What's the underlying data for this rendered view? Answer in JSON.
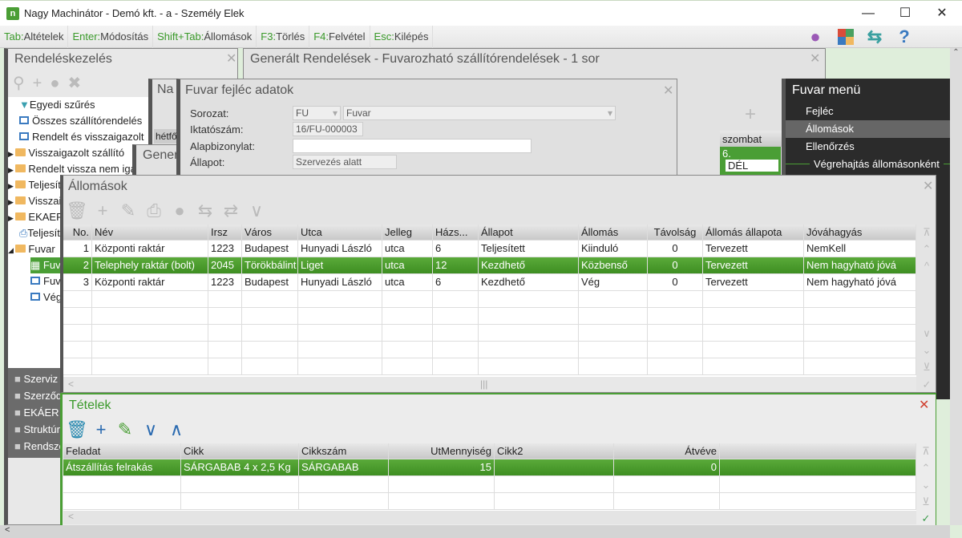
{
  "window": {
    "title": "Nagy Machinátor - Demó kft. - a - Személy Elek",
    "app_icon": "n"
  },
  "shortcuts": [
    {
      "key": "Tab:",
      "label": "Altételek"
    },
    {
      "key": "Enter:",
      "label": "Módosítás"
    },
    {
      "key": "Shift+Tab:",
      "label": "Állomások"
    },
    {
      "key": "F3:",
      "label": "Törlés"
    },
    {
      "key": "F4:",
      "label": "Felvétel"
    },
    {
      "key": "Esc:",
      "label": "Kilépés"
    }
  ],
  "left_panel": {
    "title": "Rendeléskezelés",
    "tree": [
      "Egyedi szűrés",
      "Összes szállítórendelés",
      "Rendelt és visszaigazolt",
      "Visszaigazolt szállító",
      "Rendelt vissza nem igazolt",
      "Teljesített",
      "Visszaigazolt",
      "EKAER",
      "Teljesített",
      "Fuvar",
      "Fuvar",
      "Fuvar",
      "Vég"
    ],
    "nav": [
      "Szerviz",
      "Szerződés",
      "EKÁER",
      "Struktúra",
      "Rendszer"
    ]
  },
  "gen_panel": {
    "title": "Generált Rendelések - Fuvarozható szállítórendelések - 1 sor",
    "behind_na": "Na",
    "behind_gener": "Gener",
    "day_header": "hétfő",
    "saturday": "szombat",
    "sat_day": "6.",
    "sat_entry": "DÉL"
  },
  "fuvar_header": {
    "title": "Fuvar fejléc adatok",
    "fields": [
      {
        "label": "Sorozat:",
        "value": "FU",
        "value2": "Fuvar"
      },
      {
        "label": "Iktatószám:",
        "value": "16/FU-000003"
      },
      {
        "label": "Alapbizonylat:",
        "value": ""
      },
      {
        "label": "Állapot:",
        "value": "Szervezés alatt"
      }
    ]
  },
  "fuvar_menu": {
    "title": "Fuvar menü",
    "items": [
      "Fejléc",
      "Állomások",
      "Ellenőrzés"
    ],
    "section": "Végrehajtás állomásonként",
    "selected": "Állomások"
  },
  "allomasok": {
    "title": "Állomások",
    "columns": [
      "No.",
      "Név",
      "Irsz",
      "Város",
      "Utca",
      "Jelleg",
      "Házs...",
      "Állapot",
      "Állomás",
      "Távolság",
      "Állomás állapota",
      "Jóváhagyás"
    ],
    "rows": [
      [
        "1",
        "Központi raktár",
        "1223",
        "Budapest",
        "Hunyadi László",
        "utca",
        "6",
        "Teljesített",
        "Kiinduló",
        "0",
        "Tervezett",
        "NemKell"
      ],
      [
        "2",
        "Telephely raktár (bolt)",
        "2045",
        "Törökbálint",
        "Liget",
        "utca",
        "12",
        "Kezdhető",
        "Közbenső",
        "0",
        "Tervezett",
        "Nem hagyható jóvá"
      ],
      [
        "3",
        "Központi raktár",
        "1223",
        "Budapest",
        "Hunyadi László",
        "utca",
        "6",
        "Kezdhető",
        "Vég",
        "0",
        "Tervezett",
        "Nem hagyható jóvá"
      ]
    ],
    "selected_row": 2
  },
  "tetelek": {
    "title": "Tételek",
    "columns": [
      "Feladat",
      "Cikk",
      "Cikkszám",
      "UtMennyiség",
      "Cikk2",
      "Átvéve",
      ""
    ],
    "rows": [
      [
        "Átszállítás felrakás",
        "SÁRGABAB 4 x 2,5 Kg",
        "SÁRGABAB",
        "15",
        "",
        "0",
        ""
      ]
    ]
  },
  "colors": {
    "accent": "#4a9e35",
    "menu_bg": "#2b2b2b"
  }
}
